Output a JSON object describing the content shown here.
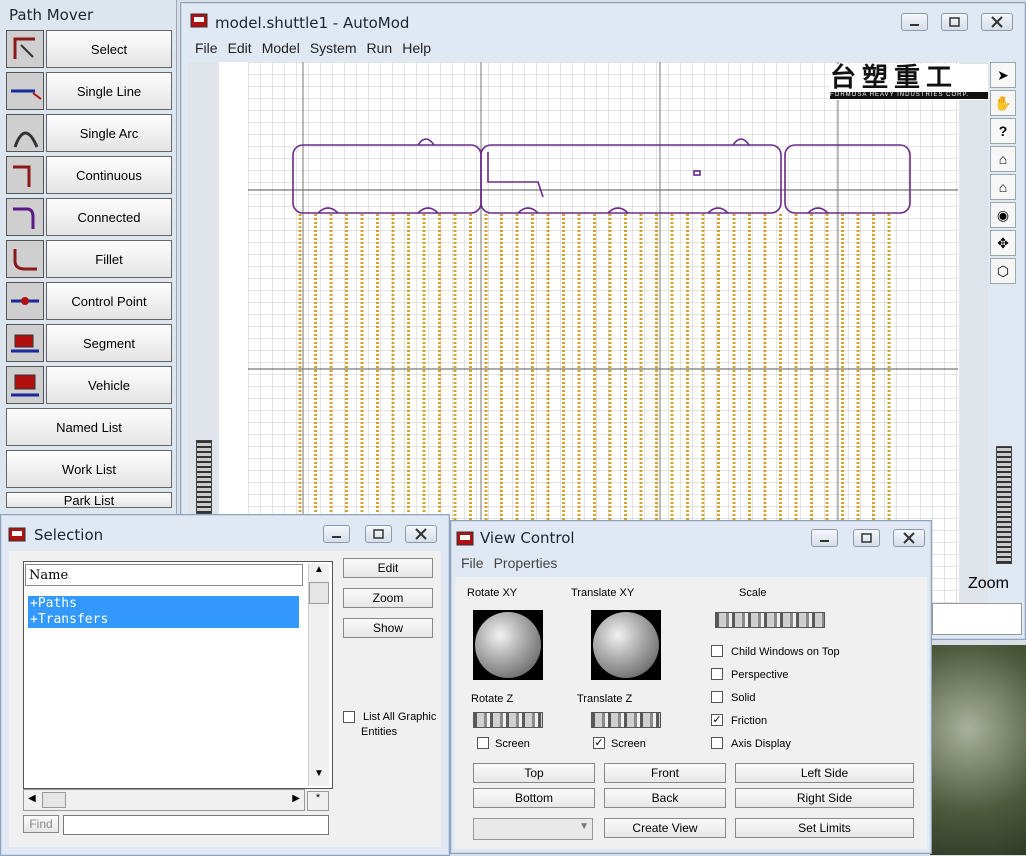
{
  "path_mover": {
    "title": "Path Mover",
    "tools": [
      {
        "label": "Select",
        "icon": "path-select-icon"
      },
      {
        "label": "Single Line",
        "icon": "single-line-icon"
      },
      {
        "label": "Single Arc",
        "icon": "single-arc-icon"
      },
      {
        "label": "Continuous",
        "icon": "continuous-icon"
      },
      {
        "label": "Connected",
        "icon": "connected-icon"
      },
      {
        "label": "Fillet",
        "icon": "fillet-icon"
      },
      {
        "label": "Control Point",
        "icon": "control-point-icon"
      },
      {
        "label": "Segment",
        "icon": "segment-icon"
      },
      {
        "label": "Vehicle",
        "icon": "vehicle-icon"
      }
    ],
    "lists": [
      "Named List",
      "Work List",
      "Park List"
    ]
  },
  "main": {
    "title": "model.shuttle1 - AutoMod",
    "menu": [
      "File",
      "Edit",
      "Model",
      "System",
      "Run",
      "Help"
    ],
    "logo_text": "台塑重工",
    "logo_sub": "FORMOSA HEAVY INDUSTRIES CORP.",
    "zoom_label": "Zoom"
  },
  "selection": {
    "title": "Selection",
    "column_header": "Name",
    "items": [
      "+Paths",
      "+Transfers"
    ],
    "buttons": {
      "edit": "Edit",
      "zoom": "Zoom",
      "show": "Show"
    },
    "list_all_label_1": "List All Graphic",
    "list_all_label_2": "Entities",
    "find_label": "Find",
    "find_value": "",
    "scroll_corner": "*"
  },
  "view_control": {
    "title": "View Control",
    "menu": [
      "File",
      "Properties"
    ],
    "labels": {
      "rotate_xy": "Rotate XY",
      "translate_xy": "Translate XY",
      "scale": "Scale",
      "rotate_z": "Rotate Z",
      "translate_z": "Translate Z"
    },
    "screen_label": "Screen",
    "rotate_screen_checked": false,
    "translate_screen_checked": true,
    "options": [
      {
        "label": "Child Windows on Top",
        "checked": false
      },
      {
        "label": "Perspective",
        "checked": false
      },
      {
        "label": "Solid",
        "checked": false
      },
      {
        "label": "Friction",
        "checked": true
      },
      {
        "label": "Axis Display",
        "checked": false
      }
    ],
    "buttons": {
      "top": "Top",
      "front": "Front",
      "left_side": "Left Side",
      "bottom": "Bottom",
      "back": "Back",
      "right_side": "Right Side",
      "create_view": "Create View",
      "set_limits": "Set Limits"
    },
    "view_select_value": ""
  },
  "colors": {
    "path": "#6a2a8a",
    "transfer": "#d4a32a",
    "accent": "#3399ff"
  }
}
